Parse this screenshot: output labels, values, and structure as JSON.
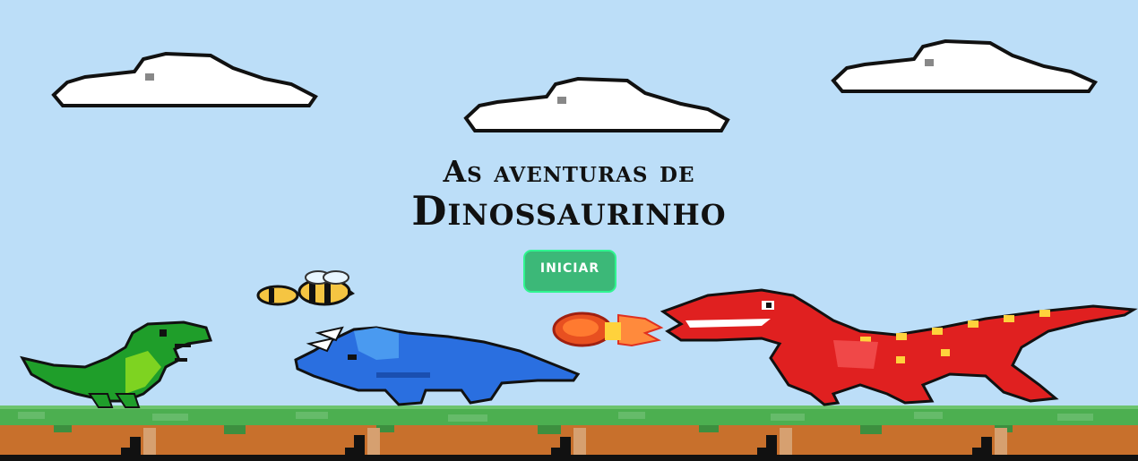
{
  "game": {
    "title_line1": "As aventuras de",
    "title_line2": "Dinossaurinho",
    "start_button": "INICIAR"
  },
  "colors": {
    "sky": "#bcdef8",
    "grass": "#4caf50",
    "dirt": "#c86e2c",
    "button": "#3cb878",
    "green_dino": "#1f9e2a",
    "blue_dino": "#2a6fe0",
    "red_dino": "#e02020"
  },
  "icons": [
    "cloud-icon",
    "bee-icon",
    "fireball-icon"
  ]
}
